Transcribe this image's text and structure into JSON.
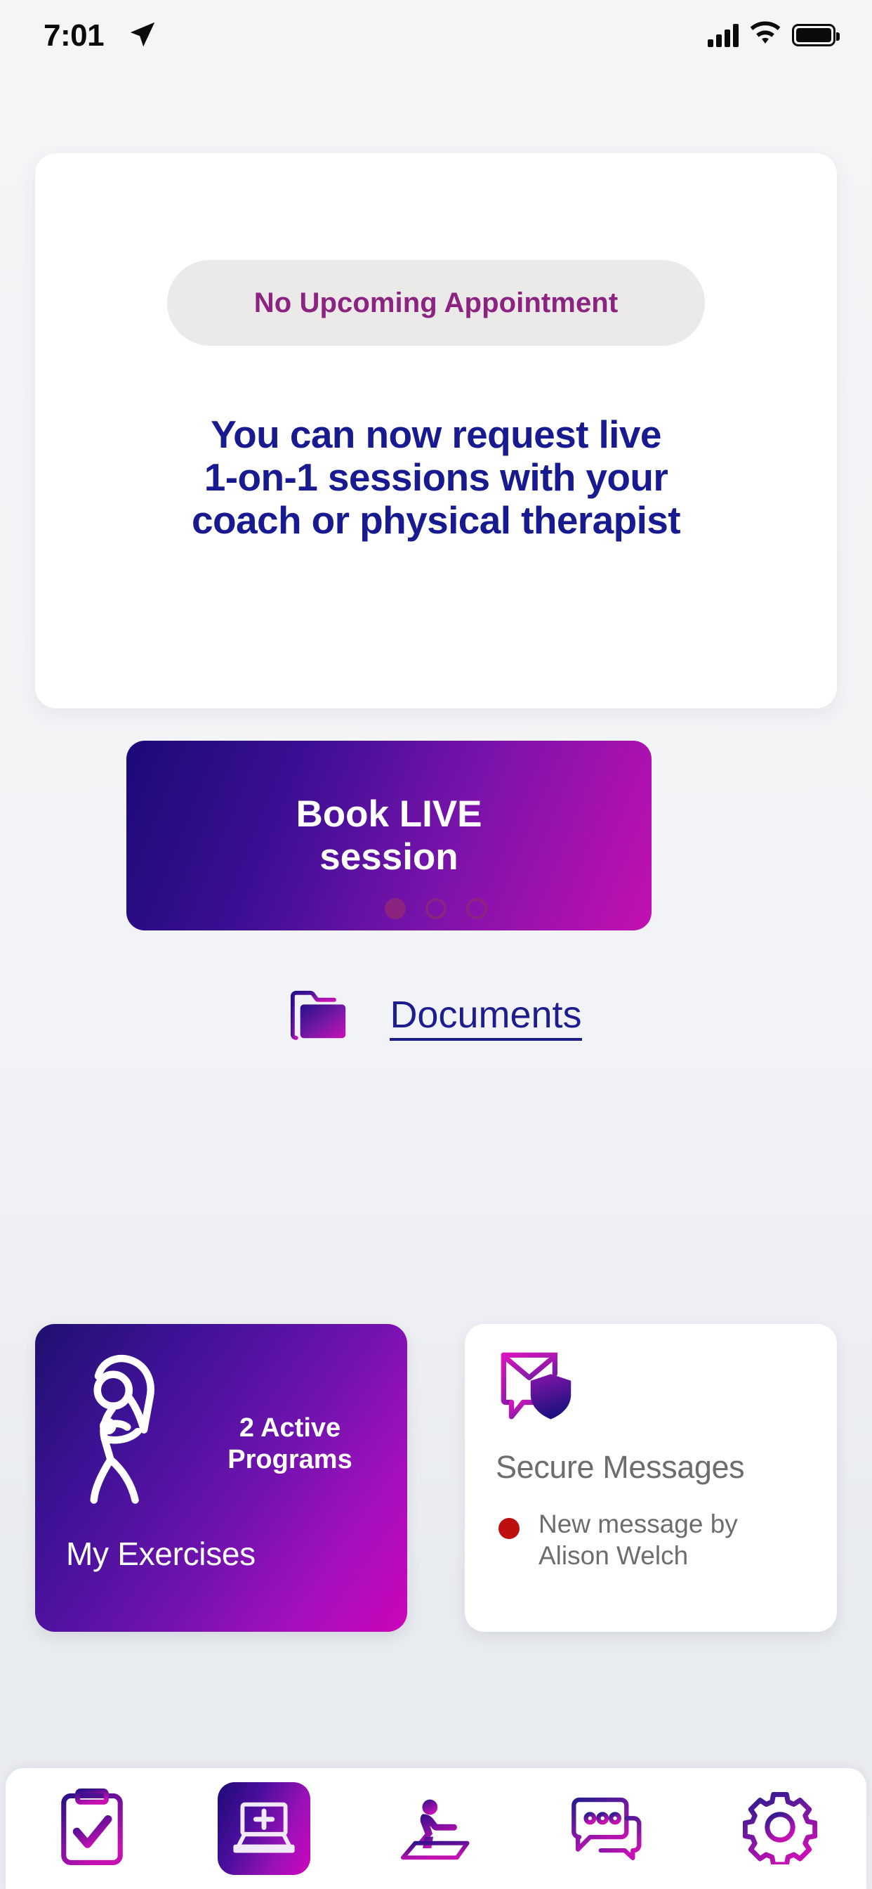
{
  "statusbar": {
    "time": "7:01",
    "location_icon": "location-arrow-icon",
    "signal_icon": "cellular-signal-icon",
    "wifi_icon": "wifi-icon",
    "battery_icon": "battery-full-icon"
  },
  "hero": {
    "appointment_status": "No Upcoming Appointment",
    "headline_line1": "You can now request live",
    "headline_line2": "1-on-1 sessions with your",
    "headline_line3": "coach or physical therapist",
    "book_button_line1": "Book LIVE",
    "book_button_line2": "session",
    "documents_label": "Documents",
    "documents_icon": "folder-icon"
  },
  "pager": {
    "dots": [
      {
        "active": true
      },
      {
        "active": false
      },
      {
        "active": false
      }
    ]
  },
  "cards": {
    "exercise": {
      "icon": "stretching-person-icon",
      "count_line1": "2 Active",
      "count_line2": "Programs",
      "title": "My Exercises"
    },
    "messages": {
      "icon": "secure-envelope-shield-icon",
      "title": "Secure Messages",
      "unread_line1": "New message by",
      "unread_line2": "Alison Welch",
      "unread_dot_color": "#bd0f0f"
    }
  },
  "bottom_nav": {
    "items": [
      {
        "name": "clipboard-check-icon",
        "active": false
      },
      {
        "name": "laptop-plus-icon",
        "active": true
      },
      {
        "name": "exercise-person-icon",
        "active": false
      },
      {
        "name": "chat-bubbles-icon",
        "active": false
      },
      {
        "name": "gear-icon",
        "active": false
      }
    ]
  },
  "colors": {
    "brand_navy": "#181a8f",
    "brand_purple": "#8b2480",
    "brand_magenta": "#cc04b9",
    "background": "#f4f5f7"
  }
}
